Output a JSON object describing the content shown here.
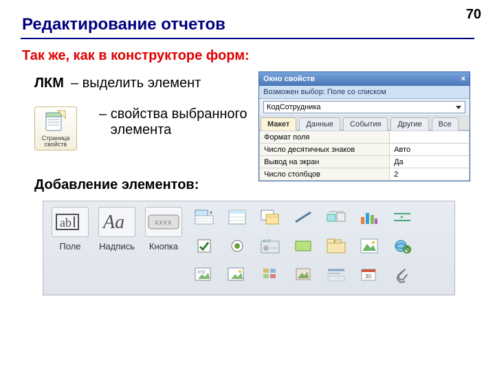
{
  "page_number": "70",
  "title": "Редактирование отчетов",
  "subtitle": "Так же, как в конструкторе форм:",
  "lkm_label": "ЛКМ",
  "lkm_desc": "– выделить  элемент",
  "props_desc_l1": "свойства выбранного",
  "props_desc_l2": "элемента",
  "props_btn_l1": "Страница",
  "props_btn_l2": "свойств",
  "add_heading": "Добавление элементов:",
  "propwin": {
    "title": "Окно свойств",
    "subhdr": "Возможен выбор:  Поле со списком",
    "combo_value": "КодСотрудника",
    "tabs": [
      "Макет",
      "Данные",
      "События",
      "Другие",
      "Все"
    ],
    "rows": [
      {
        "k": "Формат поля",
        "v": ""
      },
      {
        "k": "Число десятичных знаков",
        "v": "Авто"
      },
      {
        "k": "Вывод на экран",
        "v": "Да"
      },
      {
        "k": "Число столбцов",
        "v": "2"
      }
    ]
  },
  "tool_labels": {
    "field": "Поле",
    "label": "Надпись",
    "button": "Кнопка"
  }
}
